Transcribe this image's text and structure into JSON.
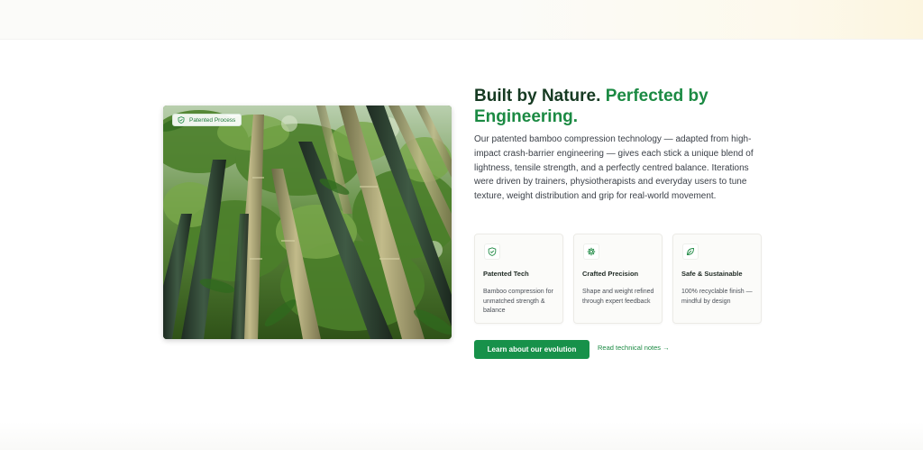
{
  "image": {
    "badge_label": "Patented Process",
    "badge_icon": "shield-check-icon",
    "subject": "bamboo-forest-photo"
  },
  "heading": {
    "part1": "Built by Nature.",
    "part2": "Perfected by Engineering."
  },
  "description": "Our patented bamboo compression technology — adapted from high-impact crash-barrier engineering — gives each stick a unique blend of lightness, tensile strength, and a perfectly centred balance. Iterations were driven by trainers, physiotherapists and everyday users to tune texture, weight distribution and grip for real-world movement.",
  "features": [
    {
      "icon": "shield-check-icon",
      "title": "Patented Tech",
      "desc": "Bamboo compression for unmatched strength & balance"
    },
    {
      "icon": "gear-icon",
      "title": "Crafted Precision",
      "desc": "Shape and weight refined through expert feedback"
    },
    {
      "icon": "leaf-icon",
      "title": "Safe & Sustainable",
      "desc": "100% recyclable finish — mindful by design"
    }
  ],
  "cta": {
    "primary_label": "Learn about our evolution",
    "secondary_label": "Read technical notes →"
  },
  "colors": {
    "accent": "#1b8a43",
    "button": "#17914a",
    "heading_dark": "#163a22"
  }
}
